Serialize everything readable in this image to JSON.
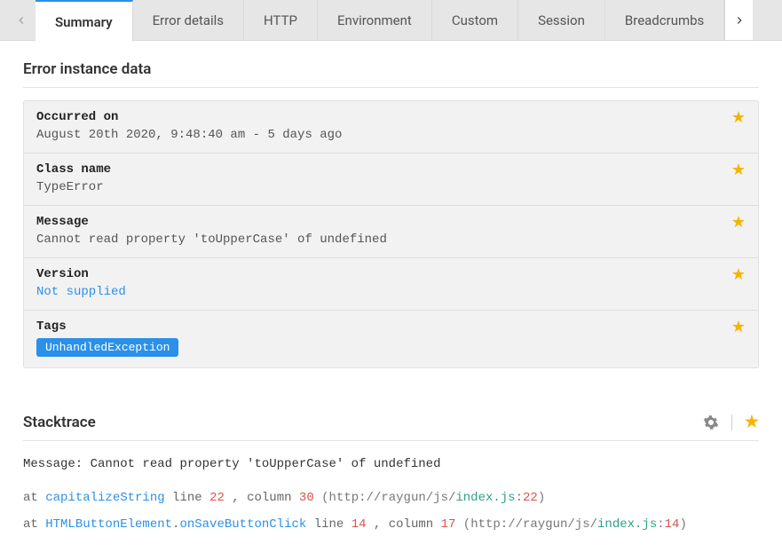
{
  "tabs": [
    "Summary",
    "Error details",
    "HTTP",
    "Environment",
    "Custom",
    "Session",
    "Breadcrumbs"
  ],
  "activeTabIndex": 0,
  "section": {
    "title": "Error instance data",
    "rows": [
      {
        "label": "Occurred on",
        "value": "August 20th 2020, 9:48:40 am - 5 days ago",
        "link": false
      },
      {
        "label": "Class name",
        "value": "TypeError",
        "link": false
      },
      {
        "label": "Message",
        "value": "Cannot read property 'toUpperCase' of undefined",
        "link": false
      },
      {
        "label": "Version",
        "value": "Not supplied",
        "link": true
      },
      {
        "label": "Tags",
        "value": "UnhandledException",
        "tag": true
      }
    ]
  },
  "stacktrace": {
    "title": "Stacktrace",
    "messageLabel": "Message:",
    "message": "Cannot read property 'toUpperCase' of undefined",
    "frames": [
      {
        "at": "at",
        "fn": "capitalizeString",
        "lineLabel": "line",
        "line": "22",
        "comma1": ",",
        "colLabel": "column",
        "col": "30",
        "open": "(",
        "urlPrefix": "http://raygun/js/",
        "file": "index.js",
        "colon": ":",
        "fileLine": "22",
        "close": ")"
      },
      {
        "at": "at",
        "cls": "HTMLButtonElement",
        "dot": ".",
        "fn": "onSaveButtonClick",
        "lineLabel": "line",
        "line": "14",
        "comma1": ",",
        "colLabel": "column",
        "col": "17",
        "open": "(",
        "urlPrefix": "http://raygun/js/",
        "file": "index.js",
        "colon": ":",
        "fileLine": "14",
        "close": ")"
      }
    ]
  }
}
